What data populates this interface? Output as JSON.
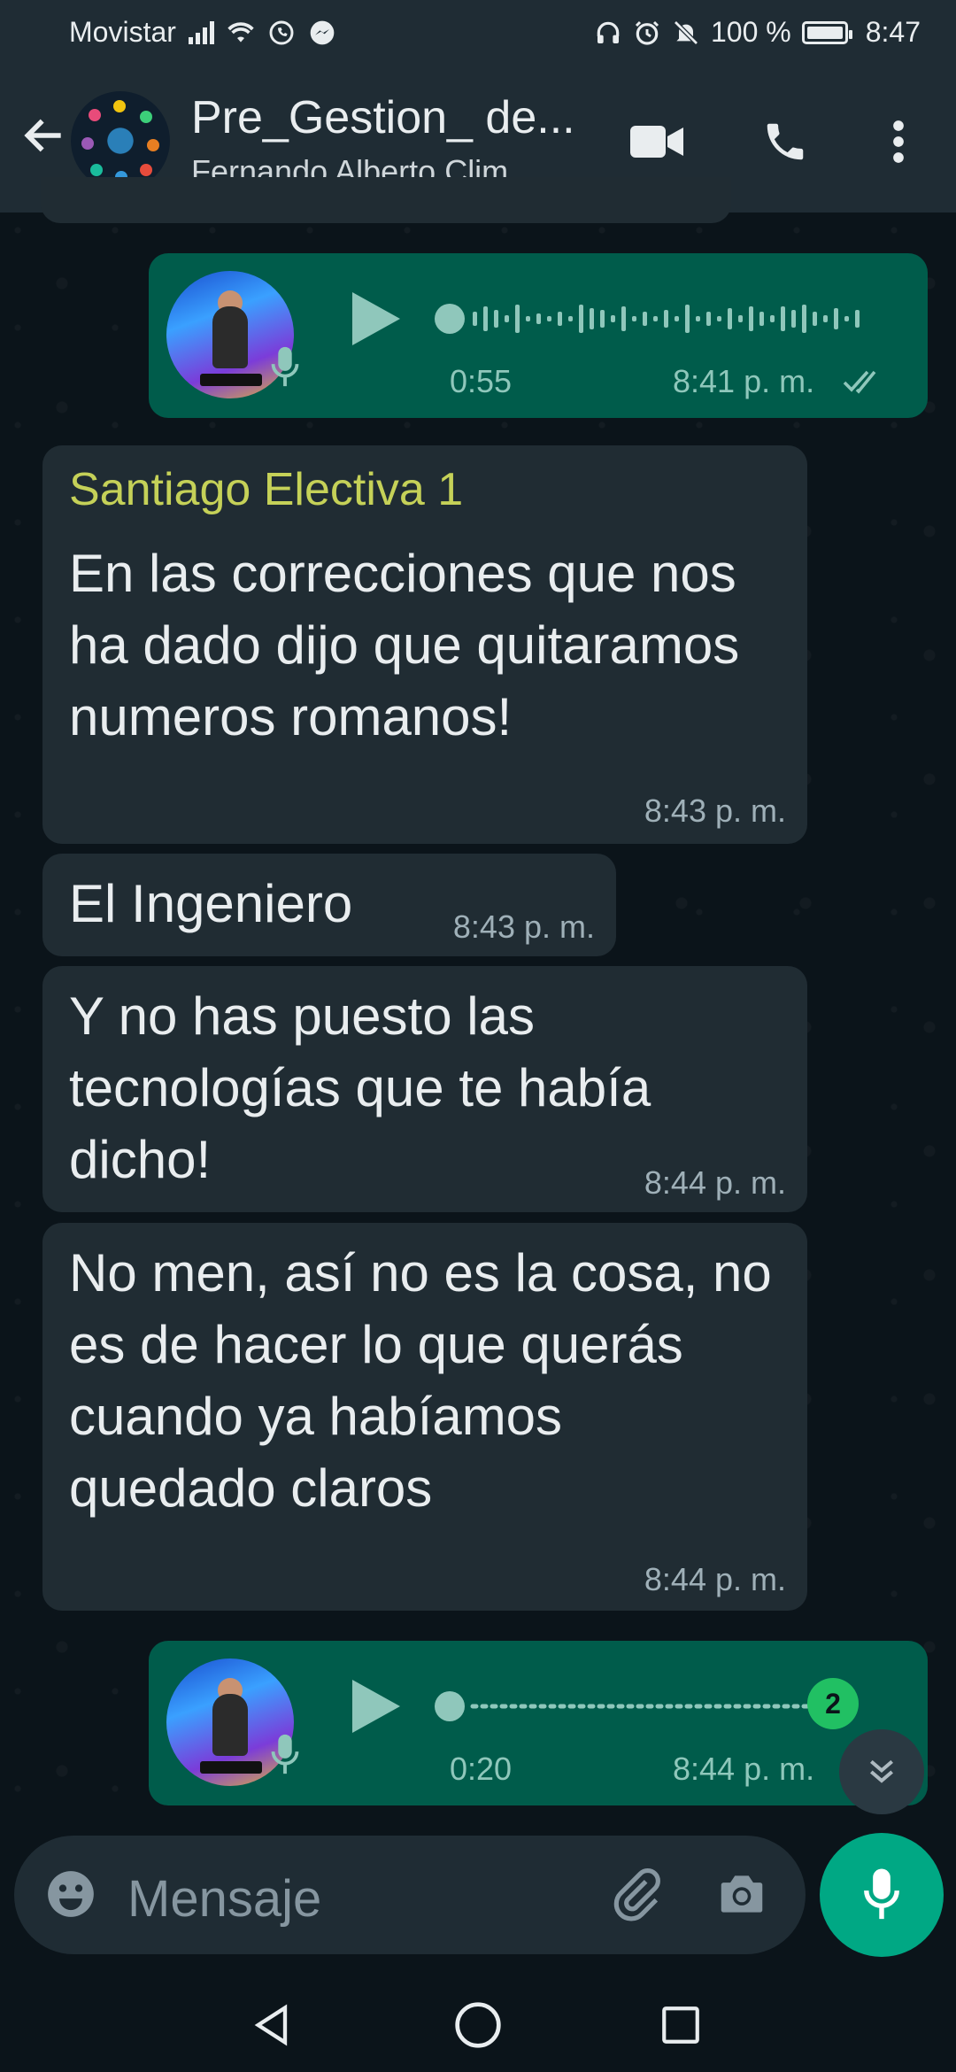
{
  "status_bar": {
    "carrier": "Movistar",
    "battery": "100 %",
    "time": "8:47"
  },
  "header": {
    "title": "Pre_Gestion_ de...",
    "subtitle": "Fernando Alberto Clim..."
  },
  "messages": [
    {
      "type": "voice",
      "direction": "outgoing",
      "duration": "0:55",
      "time": "8:41 p. m.",
      "status": "read"
    },
    {
      "type": "text",
      "direction": "incoming",
      "sender": "Santiago Electiva 1",
      "text": "En las correcciones que nos ha dado dijo que quitaramos numeros romanos!",
      "time": "8:43 p. m."
    },
    {
      "type": "text",
      "direction": "incoming",
      "text": "El Ingeniero",
      "time": "8:43 p. m."
    },
    {
      "type": "text",
      "direction": "incoming",
      "text": "Y no has puesto las tecnologías que te había dicho!",
      "time": "8:44 p. m."
    },
    {
      "type": "text",
      "direction": "incoming",
      "text": "No men, así no es la cosa, no es de hacer lo que querás cuando ya habíamos quedado claros",
      "time": "8:44 p. m."
    },
    {
      "type": "voice",
      "direction": "outgoing",
      "duration": "0:20",
      "time": "8:44 p. m."
    }
  ],
  "unread_count": "2",
  "input": {
    "placeholder": "Mensaje"
  },
  "colors": {
    "header_bg": "#1f2c34",
    "incoming_bubble": "#202c33",
    "outgoing_bubble": "#005c4b",
    "accent": "#00a884",
    "sender_name": "#c5d158"
  }
}
